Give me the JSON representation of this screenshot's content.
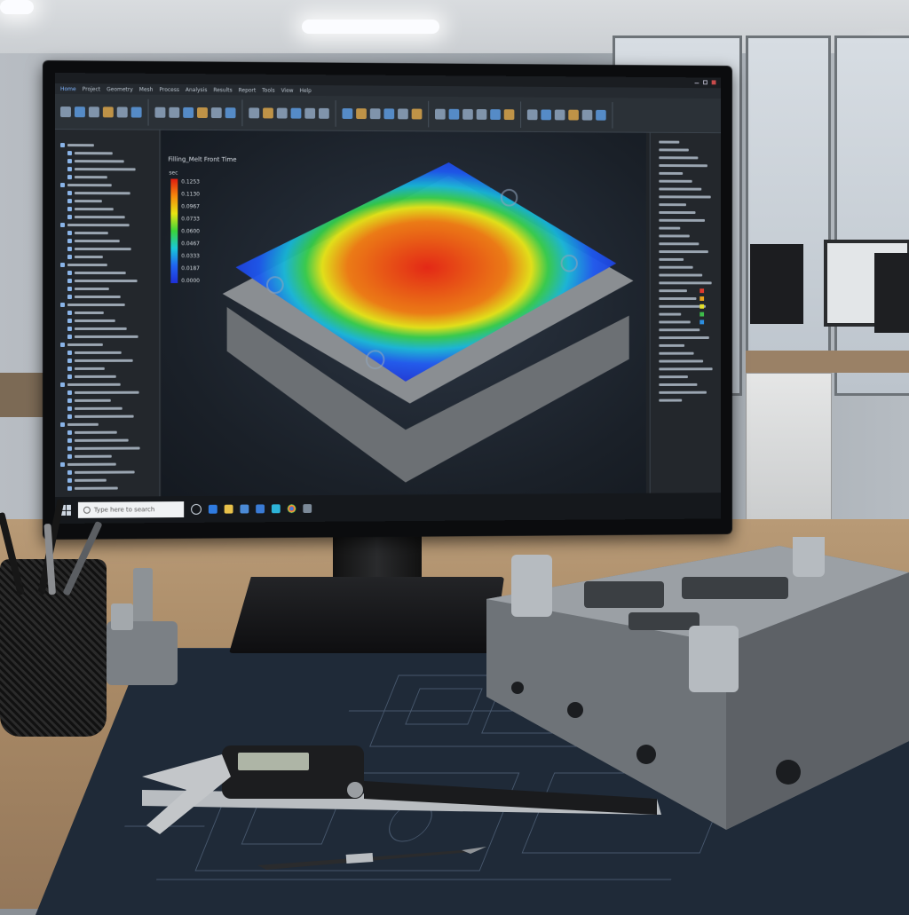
{
  "app": {
    "menu": [
      "Home",
      "Project",
      "Geometry",
      "Mesh",
      "Process",
      "Analysis",
      "Results",
      "Report",
      "Tools",
      "View",
      "Help"
    ],
    "active_menu_index": 0
  },
  "viewport": {
    "result_title": "Filling_Melt Front Time",
    "legend_unit": "sec",
    "legend_values": [
      "0.1253",
      "0.1130",
      "0.0967",
      "0.0733",
      "0.0600",
      "0.0467",
      "0.0333",
      "0.0187",
      "0.0000"
    ],
    "legend_colors": [
      "#e01c10",
      "#f58a0c",
      "#e8e412",
      "#3ad43a",
      "#19c7d8",
      "#2063f0",
      "#1e2fd8"
    ]
  },
  "taskbar": {
    "search_placeholder": "Type here to search",
    "icon_names": [
      "task-view-icon",
      "edge-icon",
      "explorer-icon",
      "store-icon",
      "mail-icon",
      "app-icon",
      "chrome-icon",
      "cad-icon"
    ]
  },
  "scene": {
    "monitor_color": "#0b0c0e",
    "desk_color": "#a98a66",
    "blueprint_color": "#1f2a38"
  }
}
